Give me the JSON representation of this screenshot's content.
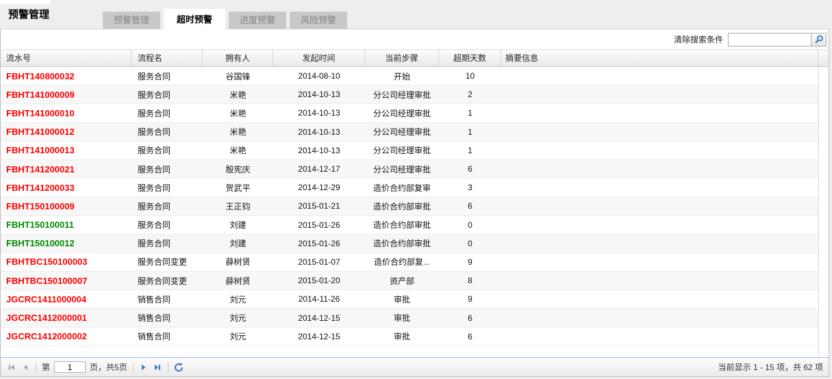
{
  "page": {
    "title": "预警管理"
  },
  "tabs": [
    {
      "label": "预警管理",
      "active": false
    },
    {
      "label": "超时预警",
      "active": true
    },
    {
      "label": "进度预警",
      "active": false
    },
    {
      "label": "风险预警",
      "active": false
    }
  ],
  "search": {
    "clear_label": "清除搜索条件",
    "value": "",
    "icon": "magnifier-icon"
  },
  "table": {
    "columns": [
      "流水号",
      "流程名",
      "拥有人",
      "发起时间",
      "当前步骤",
      "超期天数",
      "摘要信息"
    ],
    "rows": [
      {
        "serial": "FBHT140800032",
        "serial_color": "#ff0000",
        "process": "服务合同",
        "owner": "谷国锋",
        "start_date": "2014-08-10",
        "current_step": "开始",
        "overdue_days": "10",
        "summary": ""
      },
      {
        "serial": "FBHT141000009",
        "serial_color": "#ff0000",
        "process": "服务合同",
        "owner": "米艳",
        "start_date": "2014-10-13",
        "current_step": "分公司经理审批",
        "overdue_days": "2",
        "summary": ""
      },
      {
        "serial": "FBHT141000010",
        "serial_color": "#ff0000",
        "process": "服务合同",
        "owner": "米艳",
        "start_date": "2014-10-13",
        "current_step": "分公司经理审批",
        "overdue_days": "1",
        "summary": ""
      },
      {
        "serial": "FBHT141000012",
        "serial_color": "#ff0000",
        "process": "服务合同",
        "owner": "米艳",
        "start_date": "2014-10-13",
        "current_step": "分公司经理审批",
        "overdue_days": "1",
        "summary": ""
      },
      {
        "serial": "FBHT141000013",
        "serial_color": "#ff0000",
        "process": "服务合同",
        "owner": "米艳",
        "start_date": "2014-10-13",
        "current_step": "分公司经理审批",
        "overdue_days": "1",
        "summary": ""
      },
      {
        "serial": "FBHT141200021",
        "serial_color": "#ff0000",
        "process": "服务合同",
        "owner": "殷宪庆",
        "start_date": "2014-12-17",
        "current_step": "分公司经理审批",
        "overdue_days": "6",
        "summary": ""
      },
      {
        "serial": "FBHT141200033",
        "serial_color": "#ff0000",
        "process": "服务合同",
        "owner": "贺武平",
        "start_date": "2014-12-29",
        "current_step": "造价合约部复审",
        "overdue_days": "3",
        "summary": ""
      },
      {
        "serial": "FBHT150100009",
        "serial_color": "#ff0000",
        "process": "服务合同",
        "owner": "王正钧",
        "start_date": "2015-01-21",
        "current_step": "造价合约部审批",
        "overdue_days": "6",
        "summary": ""
      },
      {
        "serial": "FBHT150100011",
        "serial_color": "#008a00",
        "process": "服务合同",
        "owner": "刘建",
        "start_date": "2015-01-26",
        "current_step": "造价合约部审批",
        "overdue_days": "0",
        "summary": ""
      },
      {
        "serial": "FBHT150100012",
        "serial_color": "#008a00",
        "process": "服务合同",
        "owner": "刘建",
        "start_date": "2015-01-26",
        "current_step": "造价合约部审批",
        "overdue_days": "0",
        "summary": ""
      },
      {
        "serial": "FBHTBC150100003",
        "serial_color": "#ff0000",
        "process": "服务合同变更",
        "owner": "薛树贤",
        "start_date": "2015-01-07",
        "current_step": "造价合约部复...",
        "overdue_days": "9",
        "summary": ""
      },
      {
        "serial": "FBHTBC150100007",
        "serial_color": "#ff0000",
        "process": "服务合同变更",
        "owner": "薛树贤",
        "start_date": "2015-01-20",
        "current_step": "资产部",
        "overdue_days": "8",
        "summary": ""
      },
      {
        "serial": "JGCRC1411000004",
        "serial_color": "#ff0000",
        "process": "销售合同",
        "owner": "刘元",
        "start_date": "2014-11-26",
        "current_step": "审批",
        "overdue_days": "9",
        "summary": ""
      },
      {
        "serial": "JGCRC1412000001",
        "serial_color": "#ff0000",
        "process": "销售合同",
        "owner": "刘元",
        "start_date": "2014-12-15",
        "current_step": "审批",
        "overdue_days": "6",
        "summary": ""
      },
      {
        "serial": "JGCRC1412000002",
        "serial_color": "#ff0000",
        "process": "销售合同",
        "owner": "刘元",
        "start_date": "2014-12-15",
        "current_step": "审批",
        "overdue_days": "6",
        "summary": ""
      }
    ]
  },
  "pagination": {
    "page_prefix": "第",
    "page_value": "1",
    "page_suffix": "页，共5页",
    "summary": "当前显示 1 - 15 项，共 62 项",
    "icons": {
      "first": "first-page-icon",
      "prev": "prev-page-icon",
      "next": "next-page-icon",
      "last": "last-page-icon",
      "refresh": "refresh-icon"
    }
  },
  "colors": {
    "overdue_red": "#ff0000",
    "ok_green": "#008a00",
    "pager_blue": "#3b77c2",
    "pager_disabled": "#a6a6a6",
    "pager_border_blue": "#99bbe8"
  }
}
